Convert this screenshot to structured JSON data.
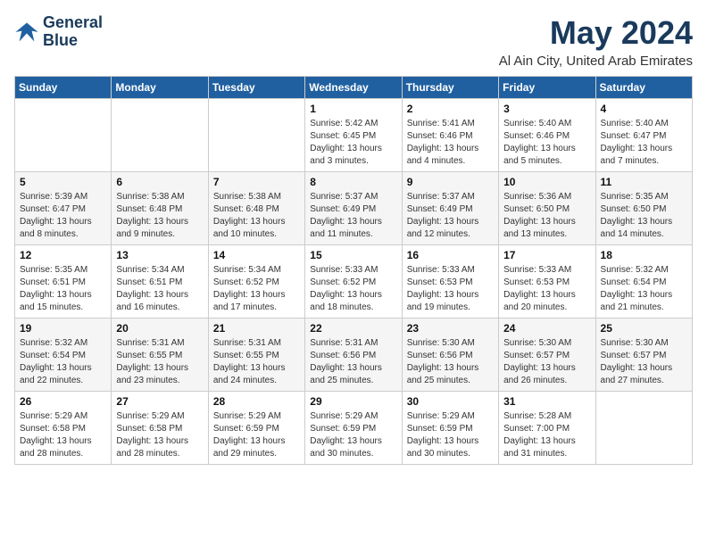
{
  "logo": {
    "line1": "General",
    "line2": "Blue"
  },
  "calendar": {
    "title": "May 2024",
    "subtitle": "Al Ain City, United Arab Emirates"
  },
  "weekdays": [
    "Sunday",
    "Monday",
    "Tuesday",
    "Wednesday",
    "Thursday",
    "Friday",
    "Saturday"
  ],
  "weeks": [
    [
      {
        "day": "",
        "info": ""
      },
      {
        "day": "",
        "info": ""
      },
      {
        "day": "",
        "info": ""
      },
      {
        "day": "1",
        "info": "Sunrise: 5:42 AM\nSunset: 6:45 PM\nDaylight: 13 hours and 3 minutes."
      },
      {
        "day": "2",
        "info": "Sunrise: 5:41 AM\nSunset: 6:46 PM\nDaylight: 13 hours and 4 minutes."
      },
      {
        "day": "3",
        "info": "Sunrise: 5:40 AM\nSunset: 6:46 PM\nDaylight: 13 hours and 5 minutes."
      },
      {
        "day": "4",
        "info": "Sunrise: 5:40 AM\nSunset: 6:47 PM\nDaylight: 13 hours and 7 minutes."
      }
    ],
    [
      {
        "day": "5",
        "info": "Sunrise: 5:39 AM\nSunset: 6:47 PM\nDaylight: 13 hours and 8 minutes."
      },
      {
        "day": "6",
        "info": "Sunrise: 5:38 AM\nSunset: 6:48 PM\nDaylight: 13 hours and 9 minutes."
      },
      {
        "day": "7",
        "info": "Sunrise: 5:38 AM\nSunset: 6:48 PM\nDaylight: 13 hours and 10 minutes."
      },
      {
        "day": "8",
        "info": "Sunrise: 5:37 AM\nSunset: 6:49 PM\nDaylight: 13 hours and 11 minutes."
      },
      {
        "day": "9",
        "info": "Sunrise: 5:37 AM\nSunset: 6:49 PM\nDaylight: 13 hours and 12 minutes."
      },
      {
        "day": "10",
        "info": "Sunrise: 5:36 AM\nSunset: 6:50 PM\nDaylight: 13 hours and 13 minutes."
      },
      {
        "day": "11",
        "info": "Sunrise: 5:35 AM\nSunset: 6:50 PM\nDaylight: 13 hours and 14 minutes."
      }
    ],
    [
      {
        "day": "12",
        "info": "Sunrise: 5:35 AM\nSunset: 6:51 PM\nDaylight: 13 hours and 15 minutes."
      },
      {
        "day": "13",
        "info": "Sunrise: 5:34 AM\nSunset: 6:51 PM\nDaylight: 13 hours and 16 minutes."
      },
      {
        "day": "14",
        "info": "Sunrise: 5:34 AM\nSunset: 6:52 PM\nDaylight: 13 hours and 17 minutes."
      },
      {
        "day": "15",
        "info": "Sunrise: 5:33 AM\nSunset: 6:52 PM\nDaylight: 13 hours and 18 minutes."
      },
      {
        "day": "16",
        "info": "Sunrise: 5:33 AM\nSunset: 6:53 PM\nDaylight: 13 hours and 19 minutes."
      },
      {
        "day": "17",
        "info": "Sunrise: 5:33 AM\nSunset: 6:53 PM\nDaylight: 13 hours and 20 minutes."
      },
      {
        "day": "18",
        "info": "Sunrise: 5:32 AM\nSunset: 6:54 PM\nDaylight: 13 hours and 21 minutes."
      }
    ],
    [
      {
        "day": "19",
        "info": "Sunrise: 5:32 AM\nSunset: 6:54 PM\nDaylight: 13 hours and 22 minutes."
      },
      {
        "day": "20",
        "info": "Sunrise: 5:31 AM\nSunset: 6:55 PM\nDaylight: 13 hours and 23 minutes."
      },
      {
        "day": "21",
        "info": "Sunrise: 5:31 AM\nSunset: 6:55 PM\nDaylight: 13 hours and 24 minutes."
      },
      {
        "day": "22",
        "info": "Sunrise: 5:31 AM\nSunset: 6:56 PM\nDaylight: 13 hours and 25 minutes."
      },
      {
        "day": "23",
        "info": "Sunrise: 5:30 AM\nSunset: 6:56 PM\nDaylight: 13 hours and 25 minutes."
      },
      {
        "day": "24",
        "info": "Sunrise: 5:30 AM\nSunset: 6:57 PM\nDaylight: 13 hours and 26 minutes."
      },
      {
        "day": "25",
        "info": "Sunrise: 5:30 AM\nSunset: 6:57 PM\nDaylight: 13 hours and 27 minutes."
      }
    ],
    [
      {
        "day": "26",
        "info": "Sunrise: 5:29 AM\nSunset: 6:58 PM\nDaylight: 13 hours and 28 minutes."
      },
      {
        "day": "27",
        "info": "Sunrise: 5:29 AM\nSunset: 6:58 PM\nDaylight: 13 hours and 28 minutes."
      },
      {
        "day": "28",
        "info": "Sunrise: 5:29 AM\nSunset: 6:59 PM\nDaylight: 13 hours and 29 minutes."
      },
      {
        "day": "29",
        "info": "Sunrise: 5:29 AM\nSunset: 6:59 PM\nDaylight: 13 hours and 30 minutes."
      },
      {
        "day": "30",
        "info": "Sunrise: 5:29 AM\nSunset: 6:59 PM\nDaylight: 13 hours and 30 minutes."
      },
      {
        "day": "31",
        "info": "Sunrise: 5:28 AM\nSunset: 7:00 PM\nDaylight: 13 hours and 31 minutes."
      },
      {
        "day": "",
        "info": ""
      }
    ]
  ]
}
